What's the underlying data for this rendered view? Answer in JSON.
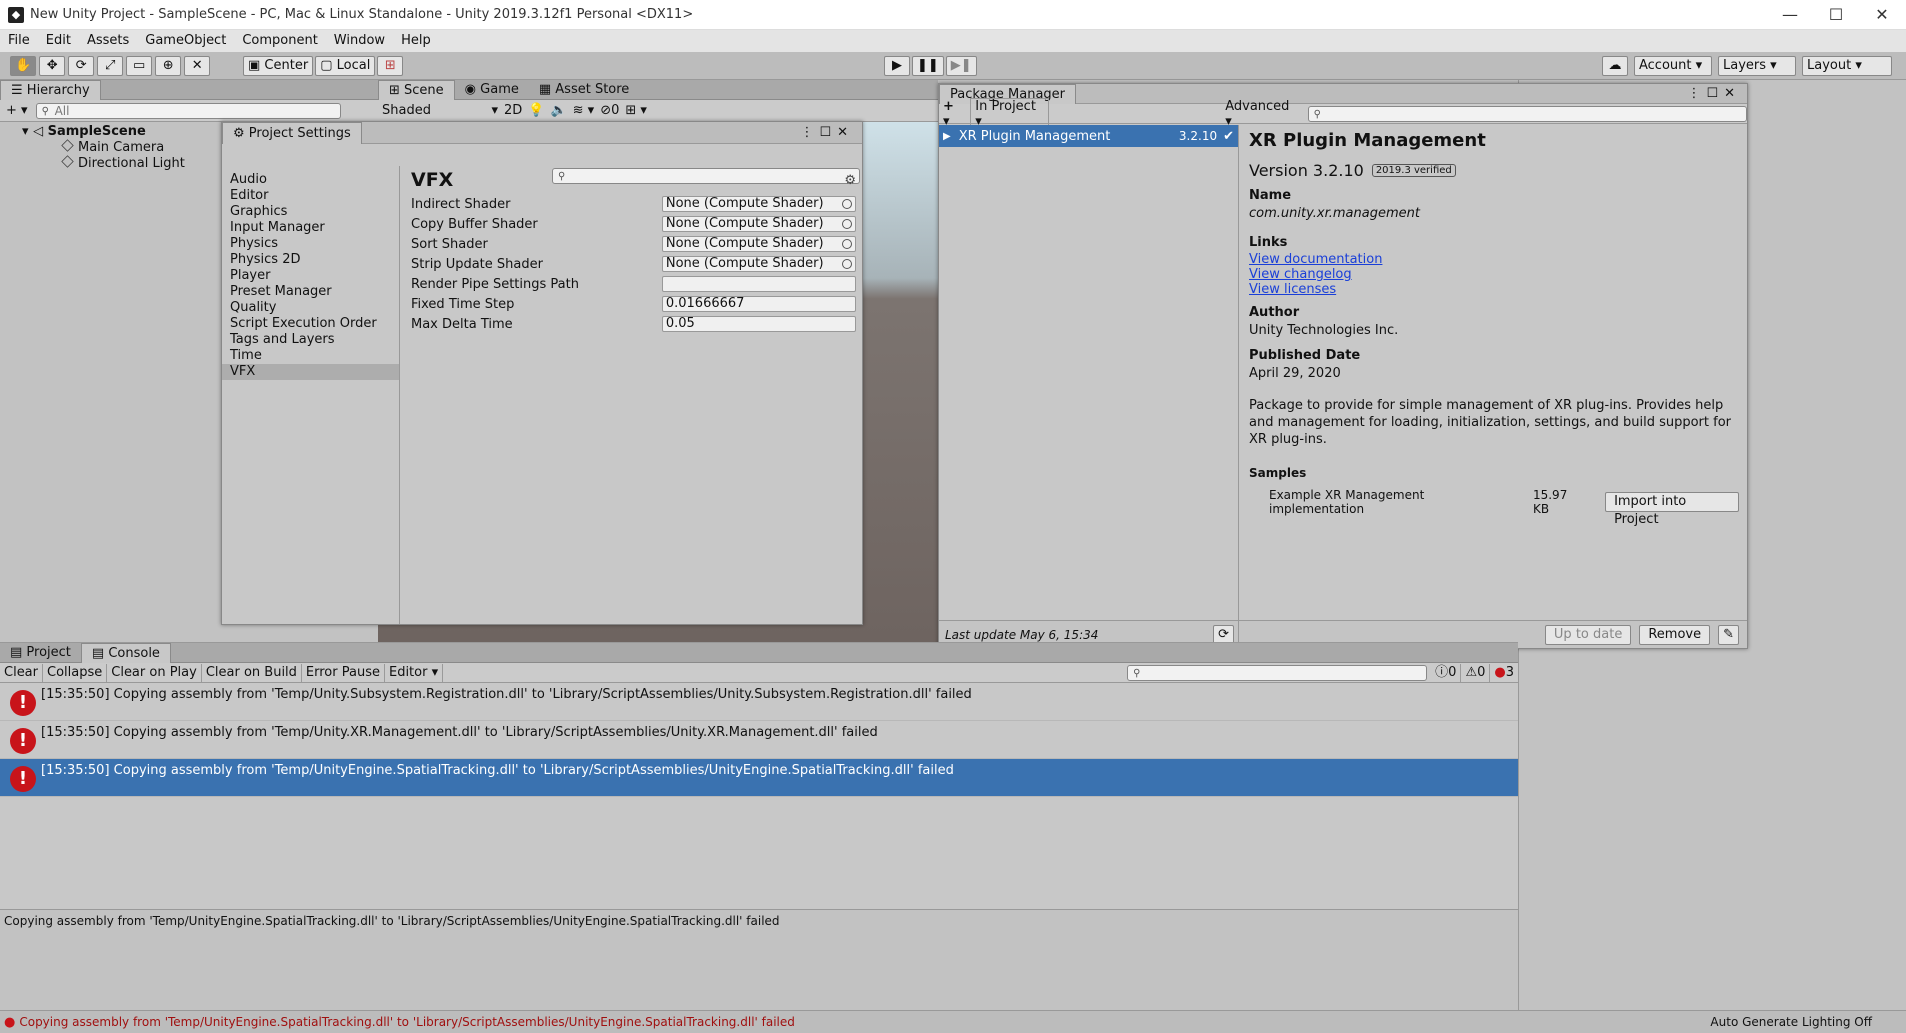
{
  "window": {
    "title": "New Unity Project - SampleScene - PC, Mac & Linux Standalone - Unity 2019.3.12f1 Personal <DX11>",
    "minimize": "—",
    "maximize": "☐",
    "close": "✕"
  },
  "menu": [
    "File",
    "Edit",
    "Assets",
    "GameObject",
    "Component",
    "Window",
    "Help"
  ],
  "toolbar": {
    "pivot": "Center",
    "space": "Local",
    "account": "Account",
    "layers": "Layers",
    "layout": "Layout"
  },
  "hierarchy": {
    "tab": "Hierarchy",
    "search_placeholder": "All",
    "scene": "SampleScene",
    "items": [
      "Main Camera",
      "Directional Light"
    ]
  },
  "scene": {
    "tabs": [
      "Scene",
      "Game",
      "Asset Store"
    ],
    "shading": "Shaded",
    "mode_2d": "2D",
    "hidden_count": "0"
  },
  "project_settings": {
    "title": "Project Settings",
    "categories": [
      "Audio",
      "Editor",
      "Graphics",
      "Input Manager",
      "Physics",
      "Physics 2D",
      "Player",
      "Preset Manager",
      "Quality",
      "Script Execution Order",
      "Tags and Layers",
      "Time",
      "VFX"
    ],
    "selected": "VFX",
    "section_title": "VFX",
    "fields": [
      {
        "label": "Indirect Shader",
        "value": "None (Compute Shader)"
      },
      {
        "label": "Copy Buffer Shader",
        "value": "None (Compute Shader)"
      },
      {
        "label": "Sort Shader",
        "value": "None (Compute Shader)"
      },
      {
        "label": "Strip Update Shader",
        "value": "None (Compute Shader)"
      },
      {
        "label": "Render Pipe Settings Path",
        "value": ""
      },
      {
        "label": "Fixed Time Step",
        "value": "0.01666667"
      },
      {
        "label": "Max Delta Time",
        "value": "0.05"
      }
    ]
  },
  "package_manager": {
    "title": "Package Manager",
    "add_label": "+",
    "filter": "In Project",
    "advanced": "Advanced",
    "list": [
      {
        "name": "XR Plugin Management",
        "version": "3.2.10"
      }
    ],
    "last_update": "Last update May 6, 15:34",
    "detail": {
      "name": "XR Plugin Management",
      "version": "Version 3.2.10",
      "verified": "2019.3 verified",
      "name_heading": "Name",
      "package_id": "com.unity.xr.management",
      "links_heading": "Links",
      "links": [
        "View documentation",
        "View changelog",
        "View licenses"
      ],
      "author_heading": "Author",
      "author": "Unity Technologies Inc.",
      "published_heading": "Published Date",
      "published": "April 29,  2020",
      "description": "Package to provide for simple management of XR plug-ins. Provides help and management for loading, initialization, settings, and build support for XR plug-ins.",
      "samples_heading": "Samples",
      "sample_name": "Example XR Management implementation",
      "sample_size": "15.97 KB",
      "import_label": "Import into Project",
      "up_to_date": "Up to date",
      "remove": "Remove"
    }
  },
  "console": {
    "tabs": [
      "Project",
      "Console"
    ],
    "buttons": [
      "Clear",
      "Collapse",
      "Clear on Play",
      "Clear on Build",
      "Error Pause",
      "Editor"
    ],
    "counts": {
      "info": "0",
      "warn": "0",
      "error": "3"
    },
    "logs": [
      "[15:35:50] Copying assembly from 'Temp/Unity.Subsystem.Registration.dll' to 'Library/ScriptAssemblies/Unity.Subsystem.Registration.dll' failed",
      "[15:35:50] Copying assembly from 'Temp/Unity.XR.Management.dll' to 'Library/ScriptAssemblies/Unity.XR.Management.dll' failed",
      "[15:35:50] Copying assembly from 'Temp/UnityEngine.SpatialTracking.dll' to 'Library/ScriptAssemblies/UnityEngine.SpatialTracking.dll' failed"
    ],
    "detail": "Copying assembly from 'Temp/UnityEngine.SpatialTracking.dll' to 'Library/ScriptAssemblies/UnityEngine.SpatialTracking.dll' failed"
  },
  "status": {
    "message": "Copying assembly from 'Temp/UnityEngine.SpatialTracking.dll' to 'Library/ScriptAssemblies/UnityEngine.SpatialTracking.dll' failed",
    "lighting": "Auto Generate Lighting Off"
  },
  "colors": {
    "error": "#c8141a",
    "selection": "#3a72b0",
    "link": "#1a3fd8"
  }
}
